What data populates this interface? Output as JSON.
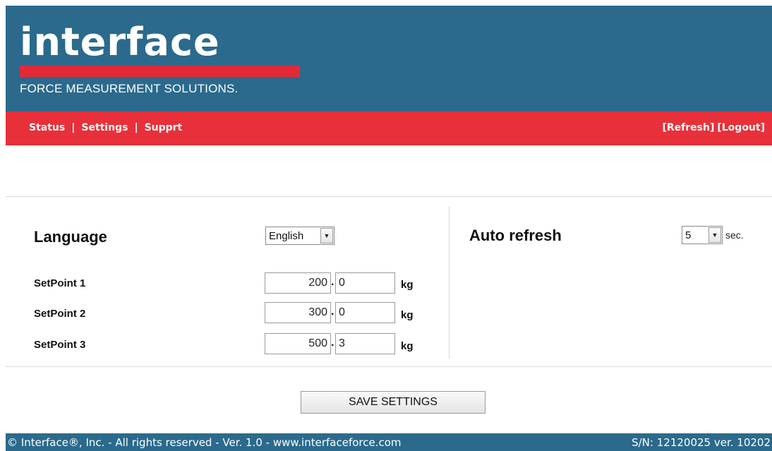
{
  "header": {
    "logo_text": "interface",
    "tagline": "FORCE MEASUREMENT SOLUTIONS.",
    "colors": {
      "header_bg": "#2b6a8c",
      "nav_bg": "#e8303a",
      "logo_bar": "#e32a36"
    }
  },
  "nav": {
    "items": [
      {
        "label": "Status"
      },
      {
        "label": "Settings"
      },
      {
        "label": "Supprt"
      }
    ],
    "separator": "|",
    "refresh_label": "[Refresh]",
    "logout_label": "[Logout]"
  },
  "settings": {
    "language": {
      "label": "Language",
      "value": "English"
    },
    "auto_refresh": {
      "label": "Auto refresh",
      "value": "5",
      "unit": "sec."
    },
    "setpoints": [
      {
        "label": "SetPoint 1",
        "integer": "200",
        "decimal": "0",
        "unit": "kg"
      },
      {
        "label": "SetPoint 2",
        "integer": "300",
        "decimal": "0",
        "unit": "kg"
      },
      {
        "label": "SetPoint 3",
        "integer": "500",
        "decimal": "3",
        "unit": "kg"
      }
    ],
    "decimal_separator": ".",
    "save_label": "SAVE SETTINGS"
  },
  "footer": {
    "copyright": "© Interface®, Inc. - All rights reserved - Ver. 1.0 - www.interfaceforce.com",
    "serial": "S/N: 12120025 ver. 10202"
  },
  "icons": {
    "select_arrow": "chevron-down-icon"
  }
}
